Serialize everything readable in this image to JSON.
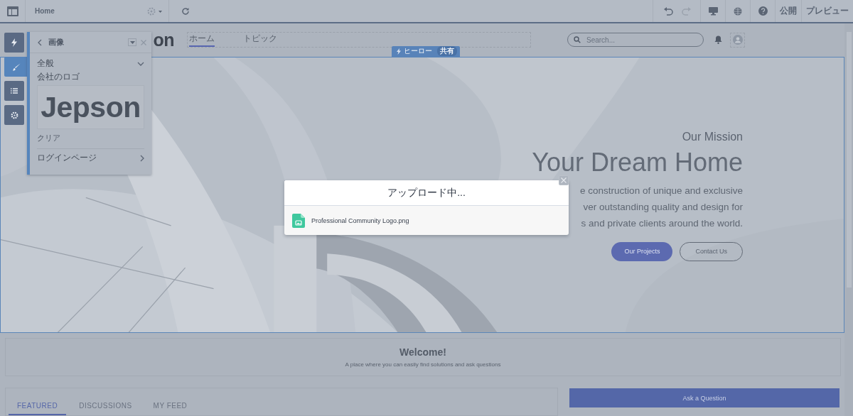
{
  "toolbar": {
    "page": "Home",
    "actions": [
      "公開",
      "プレビュー"
    ]
  },
  "builder_tools": [
    {
      "selected": false
    },
    {
      "selected": true
    },
    {
      "selected": false
    },
    {
      "selected": false
    }
  ],
  "property_panel": {
    "title": "画像",
    "section": "全般",
    "expanded": true,
    "logo_label": "会社のロゴ",
    "logo_preview": "Jepson",
    "clear_link": "クリア",
    "login_page": "ログインページ"
  },
  "site_header": {
    "logo": "on",
    "nav": [
      {
        "label": "ホーム",
        "selected": true
      },
      {
        "label": "トピック",
        "selected": false
      }
    ],
    "search": {
      "placeholder": "Search..."
    }
  },
  "component_tag": {
    "name": "ヒーロー",
    "badge": "共有"
  },
  "hero": {
    "eyebrow": "Our Mission",
    "title": "Your Dream Home",
    "lines": [
      "e construction of unique and exclusive",
      "ver outstanding quality and design for",
      "s and private clients around the world."
    ],
    "buttons": [
      {
        "label": "Our Projects",
        "kind": "primary"
      },
      {
        "label": "Contact Us",
        "kind": "outline"
      }
    ]
  },
  "upload_dialog": {
    "title": "アップロード中...",
    "file": "Professional Community Logo.png"
  },
  "welcome": {
    "title": "Welcome!",
    "subtitle": "A place where you can easily find solutions and ask questions"
  },
  "feed_tabs": [
    {
      "label": "FEATURED",
      "selected": true
    },
    {
      "label": "DISCUSSIONS",
      "selected": false
    },
    {
      "label": "MY FEED",
      "selected": false
    }
  ],
  "ask_button": "Ask a Question"
}
